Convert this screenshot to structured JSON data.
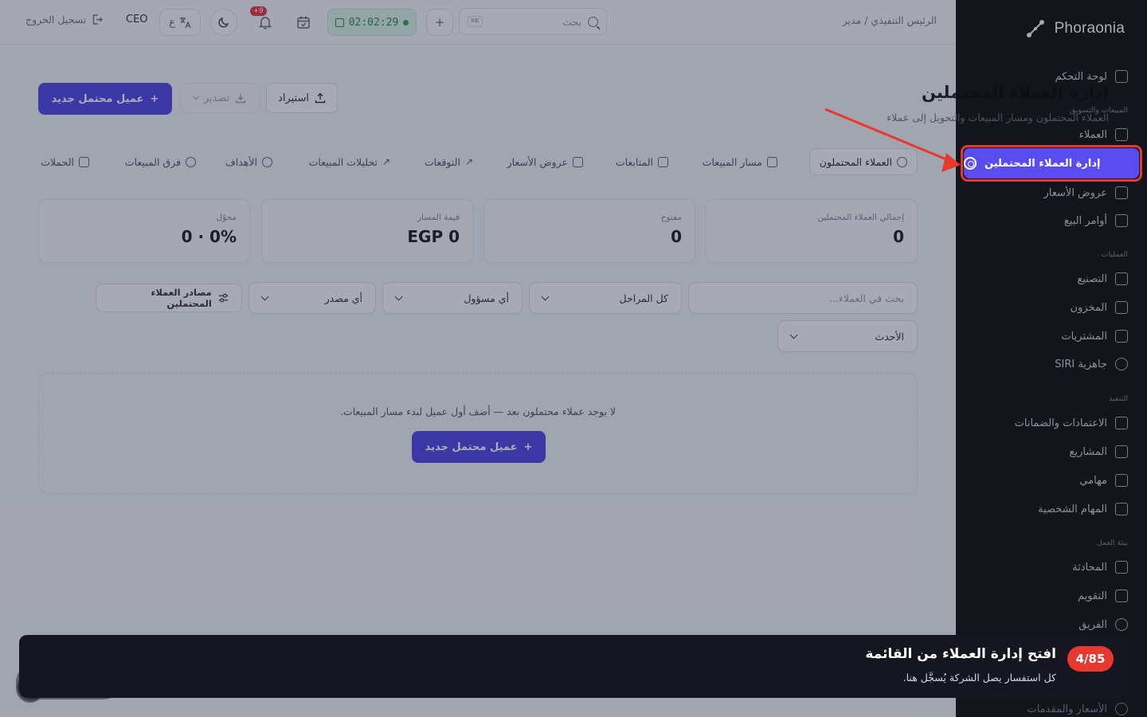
{
  "brand": {
    "name": "Phoraonia"
  },
  "sidebar": {
    "dashboard": "لوحة التحكم",
    "section_sales": "المبيعات والتسويق",
    "customers": "العملاء",
    "leads_active": "إدارة العملاء المحتملين",
    "quotes": "عروض الأسعار",
    "sales_orders": "أوامر البيع",
    "section_ops": "العمليات",
    "manufacturing": "التصنيع",
    "inventory": "المخزون",
    "purchases": "المشتريات",
    "siri": "جاهزية SIRI",
    "section_exec": "التنفيذ",
    "approvals": "الاعتمادات والضمانات",
    "projects": "المشاريع",
    "tasks": "مهامي",
    "personal_tasks": "المهام الشخصية",
    "section_work": "بيئة العمل",
    "chat": "المحادثة",
    "calendar": "التقويم",
    "team": "الفريق",
    "pricing": "الأسعار والمقدمات"
  },
  "topbar": {
    "breadcrumb": "الرئيس التنفيذي / مدير",
    "search_placeholder": "بحث",
    "shortcut": "K⌘",
    "timer": "02:02:29",
    "notif_badge": "+9",
    "lang": "ع",
    "role": "CEO",
    "logout": "تسجيل الخروج"
  },
  "page": {
    "title": "إدارة العملاء المحتملين",
    "subtitle": "العملاء المحتملون ومسار المبيعات والتحويل إلى عملاء",
    "new_lead": "عميل محتمل جديد",
    "export": "تصدير",
    "import": "استيراد"
  },
  "tabs": [
    "العملاء المحتملون",
    "مسار المبيعات",
    "المتابعات",
    "عروض الأسعار",
    "التوقعات",
    "تحليلات المبيعات",
    "الأهداف",
    "فرق المبيعات",
    "الحملات"
  ],
  "stats": [
    {
      "label": "إجمالي العملاء المحتملين",
      "value": "0"
    },
    {
      "label": "مفتوح",
      "value": "0"
    },
    {
      "label": "قيمة المسار",
      "value": "EGP 0"
    },
    {
      "label": "محوّل",
      "value": "0% · 0"
    }
  ],
  "filters": {
    "search_placeholder": "بحث في العملاء...",
    "stages": "كل المراحل",
    "owner": "أي مسؤول",
    "source": "أي مصدر",
    "lead_sources": "مصادر العملاء المحتملين",
    "sort": "الأحدث"
  },
  "empty": {
    "message": "لا يوجد عملاء محتملون بعد — أضف أول عميل لبدء مسار المبيعات.",
    "button": "عميل محتمل جديد"
  },
  "tour": {
    "counter": "4/85",
    "title": "افتح إدارة العملاء من القائمة",
    "body": "كل استفسار يصل الشركة يُسجَّل هنا."
  },
  "colors": {
    "accent": "#4a3fe0",
    "sidebar_active": "#5b4cf0",
    "highlight": "#e8392f",
    "sidebar_bg": "#1b1c27"
  }
}
